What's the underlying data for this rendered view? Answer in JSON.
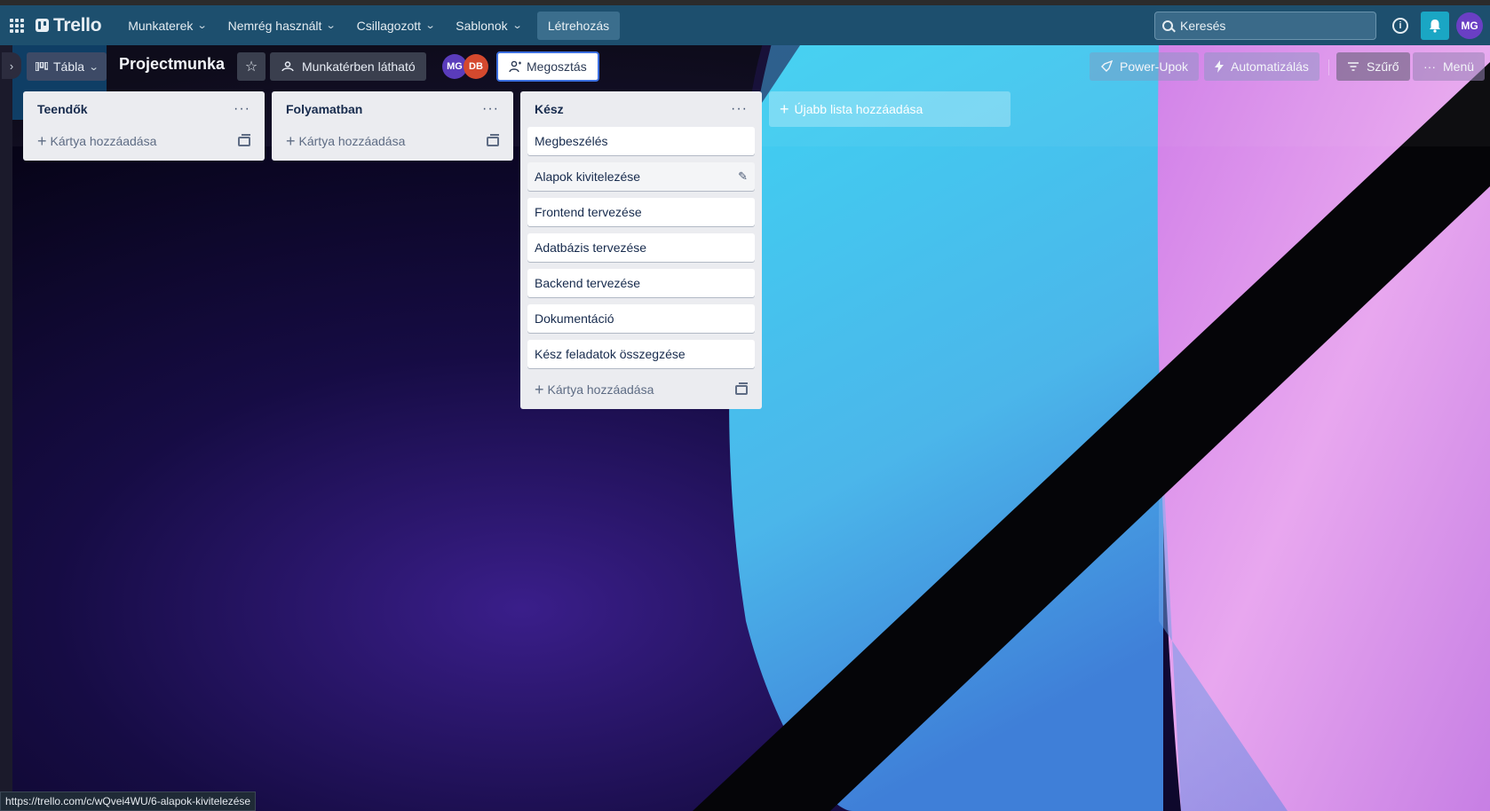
{
  "topnav": {
    "logo": "Trello",
    "items": [
      {
        "label": "Munkaterek"
      },
      {
        "label": "Nemrég használt"
      },
      {
        "label": "Csillagozott"
      },
      {
        "label": "Sablonok"
      }
    ],
    "create_label": "Létrehozás",
    "search_placeholder": "Keresés",
    "user_initials": "MG",
    "info_symbol": "i"
  },
  "board": {
    "view_label": "Tábla",
    "title": "Projectmunka",
    "visibility_label": "Munkatérben látható",
    "members": [
      "MG",
      "DB"
    ],
    "share_label": "Megosztás",
    "powerups_label": "Power-Upok",
    "automation_label": "Automatizálás",
    "filter_label": "Szűrő",
    "menu_label": "Menü"
  },
  "lists": [
    {
      "title": "Teendők",
      "cards": [],
      "add_card_label": "Kártya hozzáadása"
    },
    {
      "title": "Folyamatban",
      "cards": [],
      "add_card_label": "Kártya hozzáadása"
    },
    {
      "title": "Kész",
      "cards": [
        "Megbeszélés",
        "Alapok kivitelezése",
        "Frontend tervezése",
        "Adatbázis tervezése",
        "Backend tervezése",
        "Dokumentáció",
        "Kész feladatok összegzése"
      ],
      "add_card_label": "Kártya hozzáadása"
    }
  ],
  "add_list_label": "Újabb lista hozzáadása",
  "status_url": "https://trello.com/c/wQvei4WU/6-alapok-kivitelezése",
  "colors": {
    "nav": "#1d4f6e",
    "list_bg": "#ebecf0",
    "share_border": "#3c6fe0",
    "bell": "#1aa6c4"
  },
  "icons": [
    "apps-grid-icon",
    "trello-logo-icon",
    "chevron-down-icon",
    "search-icon",
    "info-icon",
    "bell-icon",
    "board-view-icon",
    "star-icon",
    "workspace-visibility-icon",
    "share-user-icon",
    "rocket-icon",
    "lightning-icon",
    "filter-icon",
    "more-icon",
    "plus-icon",
    "template-icon",
    "pencil-icon"
  ]
}
